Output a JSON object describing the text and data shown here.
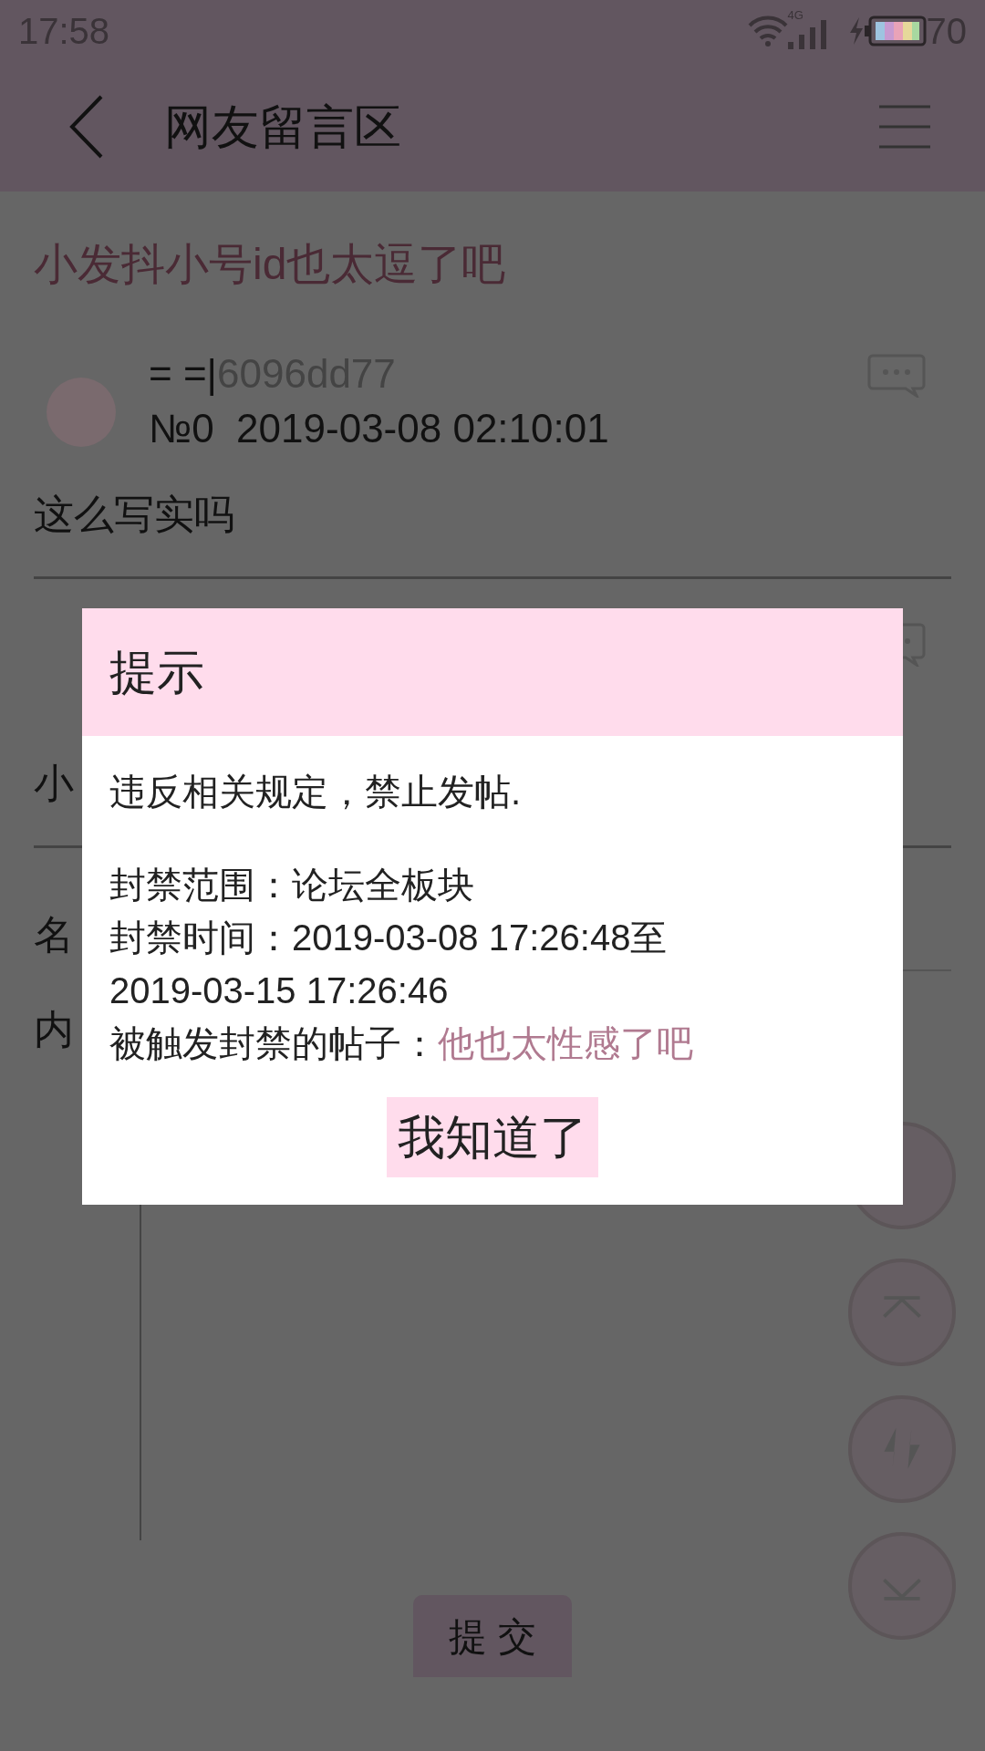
{
  "status_bar": {
    "time": "17:58",
    "network": "4G",
    "battery": "70"
  },
  "header": {
    "title": "网友留言区"
  },
  "thread_title": "小发抖小号id也太逗了吧",
  "posts": [
    {
      "name_prefix": "= =|",
      "user_id": "6096dd77",
      "meta": "№0  2019-03-08 02:10:01",
      "body": "这么写实吗"
    },
    {
      "body": "小"
    }
  ],
  "form": {
    "name_label": "名",
    "content_label": "内",
    "submit": "提 交"
  },
  "dialog": {
    "title": "提示",
    "message": "违反相关规定，禁止发帖.",
    "scope": "封禁范围：论坛全板块",
    "period": "封禁时间：2019-03-08 17:26:48至2019-03-15 17:26:46",
    "trigger_label": "被触发封禁的帖子：",
    "trigger_link": "他也太性感了吧",
    "button": "我知道了"
  }
}
